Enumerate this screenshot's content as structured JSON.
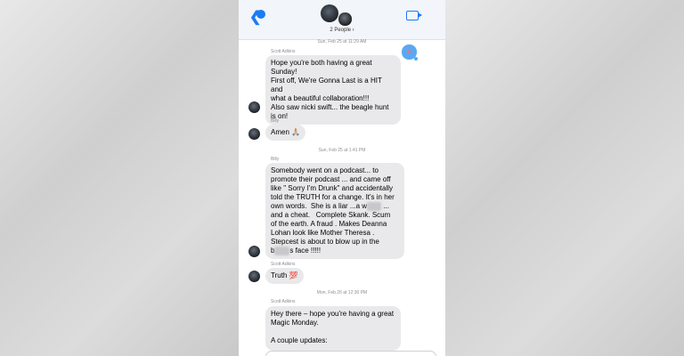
{
  "header": {
    "people_label": "2 People"
  },
  "messages": {
    "ts1": "Sun, Feb 25 at 11:29 AM",
    "sender1": "Scott Adkins",
    "msg1": "Hope you're both having a great\nSunday!\nFirst off, We're Gonna Last is a HIT and\nwhat a beautiful collaboration!!!\nAlso saw nicki swift... the beagle hunt\nis on!",
    "sender2": "Billy",
    "msg2": "Amen 🙏🏼",
    "ts2": "Sun, Feb 25 at 1:41 PM",
    "sender3": "Billy",
    "msg3a": "Somebody went on a podcast... to\npromote their podcast ... and came off\nlike \" Sorry I'm Drunk\" and accidentally\ntold the TRUTH for a change. It's in her\nown words.  She is a liar ...a w",
    "msg3_blur1": "hore",
    "msg3b": " ...\nand a cheat.   Complete Skank. Scum\nof the earth. A fraud . Makes Deanna\nLohan look like Mother Theresa .\nStepcest is about to blow up in the\nb",
    "msg3_blur2": "itche",
    "msg3c": "s face !!!!!",
    "sender4": "Scott Adkins",
    "msg4": "Truth 💯",
    "ts3": "Mon, Feb 26 at 12:30 PM",
    "sender5": "Scott Adkins",
    "msg5": "Hey there – hope you're having a great\nMagic Monday.\n\nA couple updates:"
  },
  "icons": {
    "back": "chevron-left-icon",
    "video": "video-camera-icon",
    "reaction": "heart-icon"
  },
  "colors": {
    "accent": "#1b7cf5",
    "bubble": "#e9e9eb",
    "meta_text": "#8e8e93"
  }
}
